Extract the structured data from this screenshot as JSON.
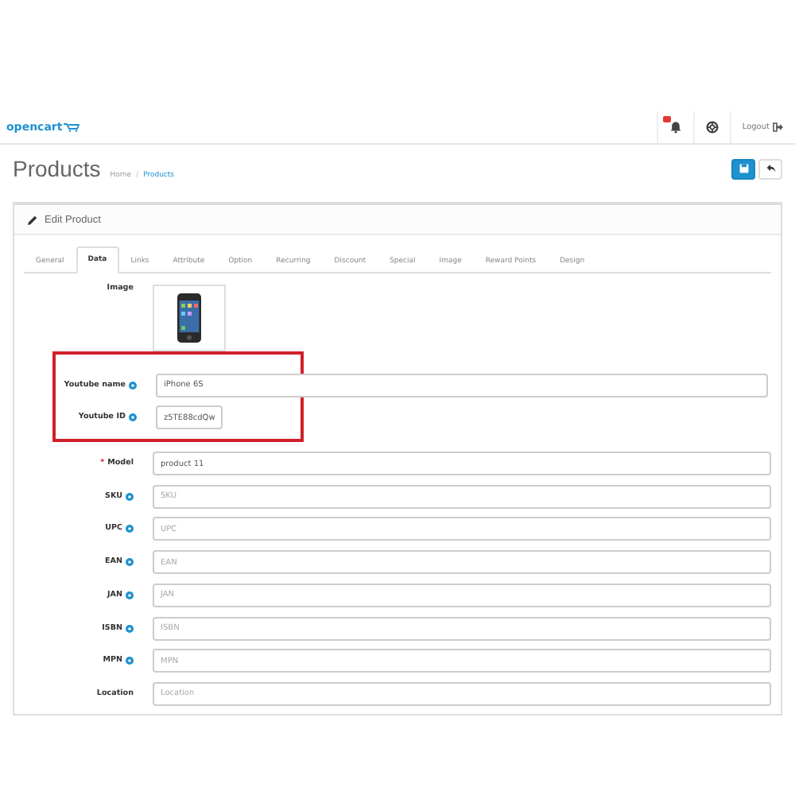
{
  "header": {
    "logo": "opencart",
    "logout": "Logout"
  },
  "page": {
    "title": "Products",
    "separator": "/",
    "breadcrumbs": [
      {
        "label": "Home",
        "current": false
      },
      {
        "label": "Products",
        "current": true
      }
    ]
  },
  "panel": {
    "title": "Edit Product"
  },
  "tabs": [
    {
      "label": "General",
      "selected": false
    },
    {
      "label": "Data",
      "selected": true
    },
    {
      "label": "Links",
      "selected": false
    },
    {
      "label": "Attribute",
      "selected": false
    },
    {
      "label": "Option",
      "selected": false
    },
    {
      "label": "Recurring",
      "selected": false
    },
    {
      "label": "Discount",
      "selected": false
    },
    {
      "label": "Special",
      "selected": false
    },
    {
      "label": "Image",
      "selected": false
    },
    {
      "label": "Reward Points",
      "selected": false
    },
    {
      "label": "Design",
      "selected": false
    }
  ],
  "fields": [
    {
      "kind": "image",
      "label": "Image",
      "help": false,
      "highlighted": false
    },
    {
      "kind": "text",
      "label": "Youtube name",
      "help": true,
      "highlighted": true,
      "value": "iPhone 6S"
    },
    {
      "kind": "short",
      "label": "Youtube ID",
      "help": true,
      "highlighted": true,
      "value": "z5TE88cdQw"
    },
    {
      "kind": "text",
      "label": "Model",
      "help": false,
      "required_mark": "*",
      "highlighted": false,
      "value": "product 11"
    },
    {
      "kind": "text",
      "label": "SKU",
      "help": true,
      "highlighted": false,
      "placeholder": "SKU"
    },
    {
      "kind": "text",
      "label": "UPC",
      "help": true,
      "highlighted": false,
      "placeholder": "UPC"
    },
    {
      "kind": "text",
      "label": "EAN",
      "help": true,
      "highlighted": false,
      "placeholder": "EAN"
    },
    {
      "kind": "text",
      "label": "JAN",
      "help": true,
      "highlighted": false,
      "placeholder": "JAN"
    },
    {
      "kind": "text",
      "label": "ISBN",
      "help": true,
      "highlighted": false,
      "placeholder": "ISBN"
    },
    {
      "kind": "text",
      "label": "MPN",
      "help": true,
      "highlighted": false,
      "placeholder": "MPN"
    },
    {
      "kind": "text",
      "label": "Location",
      "help": false,
      "highlighted": false,
      "placeholder": "Location"
    }
  ]
}
